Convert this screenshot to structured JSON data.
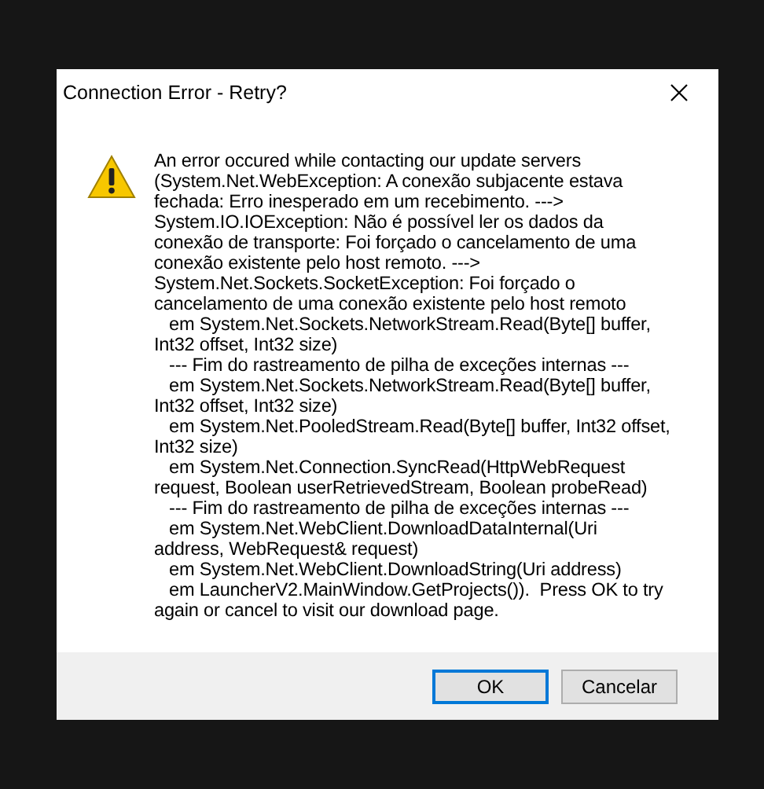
{
  "window": {
    "title": "Connection Error - Retry?"
  },
  "message": "An error occured while contacting our update servers\n(System.Net.WebException: A conexão subjacente estava\nfechada: Erro inesperado em um recebimento. --->\nSystem.IO.IOException: Não é possível ler os dados da\nconexão de transporte: Foi forçado o cancelamento de uma\nconexão existente pelo host remoto. --->\nSystem.Net.Sockets.SocketException: Foi forçado o\ncancelamento de uma conexão existente pelo host remoto\n   em System.Net.Sockets.NetworkStream.Read(Byte[] buffer,\nInt32 offset, Int32 size)\n   --- Fim do rastreamento de pilha de exceções internas ---\n   em System.Net.Sockets.NetworkStream.Read(Byte[] buffer,\nInt32 offset, Int32 size)\n   em System.Net.PooledStream.Read(Byte[] buffer, Int32 offset,\nInt32 size)\n   em System.Net.Connection.SyncRead(HttpWebRequest\nrequest, Boolean userRetrievedStream, Boolean probeRead)\n   --- Fim do rastreamento de pilha de exceções internas ---\n   em System.Net.WebClient.DownloadDataInternal(Uri\naddress, WebRequest& request)\n   em System.Net.WebClient.DownloadString(Uri address)\n   em LauncherV2.MainWindow.GetProjects()).  Press OK to try\nagain or cancel to visit our download page.",
  "buttons": [
    {
      "label": "OK",
      "selected": true
    },
    {
      "label": "Cancelar",
      "selected": false
    }
  ]
}
